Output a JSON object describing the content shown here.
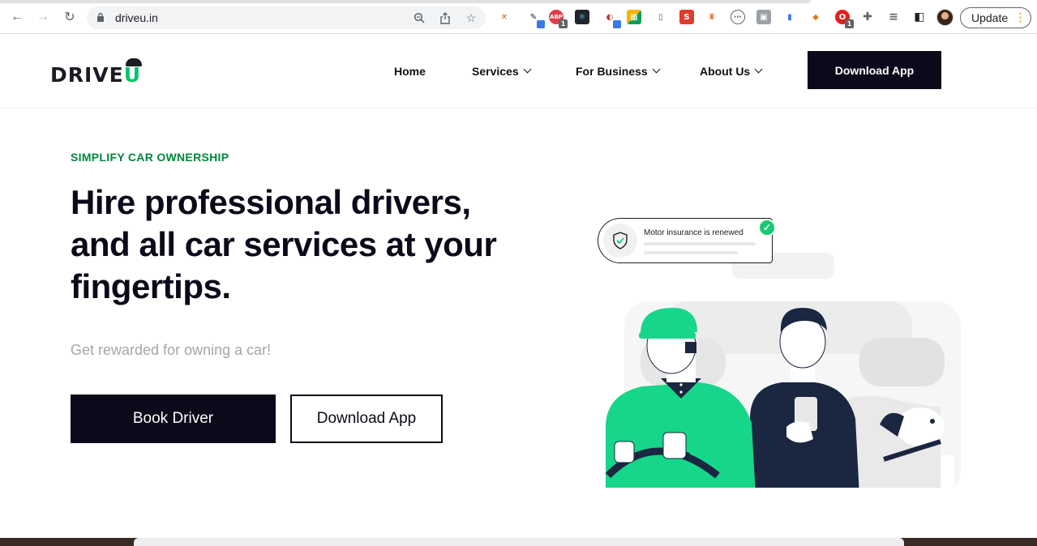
{
  "browser": {
    "url": "driveu.in",
    "update_label": "Update",
    "extensions": [
      {
        "icon": "pencil-x-extension-icon",
        "color": "#e8b339",
        "glyph": "✕"
      },
      {
        "icon": "eyedropper-extension-icon",
        "color": "#ffffff",
        "glyph": "✎"
      },
      {
        "icon": "adblock-extension-icon",
        "color": "#e03c4b",
        "glyph": "ABP",
        "badge": "1"
      },
      {
        "icon": "react-devtools-icon",
        "color": "#20232a",
        "glyph": "⚛"
      },
      {
        "icon": "colorzilla-extension-icon",
        "color": "#ffffff",
        "glyph": "◐"
      },
      {
        "icon": "grid-extension-icon",
        "color": "#ffffff",
        "glyph": "▦"
      },
      {
        "icon": "phone-extension-icon",
        "color": "#ffffff",
        "glyph": "▯"
      },
      {
        "icon": "seo-extension-icon",
        "color": "#e03c2e",
        "glyph": "S"
      },
      {
        "icon": "hacker-extension-icon",
        "color": "#ffffff",
        "glyph": "♜"
      },
      {
        "icon": "loom-extension-icon",
        "color": "#ffffff",
        "glyph": "◎"
      },
      {
        "icon": "screenshot-extension-icon",
        "color": "#ffffff",
        "glyph": "▣"
      },
      {
        "icon": "mobile-view-extension-icon",
        "color": "#ffffff",
        "glyph": "▮"
      },
      {
        "icon": "metamask-extension-icon",
        "color": "#ffffff",
        "glyph": "🦊"
      },
      {
        "icon": "opera-extension-icon",
        "color": "#ffffff",
        "glyph": "O",
        "badge": "1"
      },
      {
        "icon": "puzzle-extensions-icon",
        "color": "#ffffff",
        "glyph": "✚"
      },
      {
        "icon": "media-control-icon",
        "color": "#ffffff",
        "glyph": "≡"
      },
      {
        "icon": "side-panel-icon",
        "color": "#ffffff",
        "glyph": "◧"
      }
    ]
  },
  "site": {
    "nav": {
      "home": "Home",
      "services": "Services",
      "for_business": "For Business",
      "about_us": "About Us",
      "download_app": "Download App"
    },
    "hero": {
      "eyebrow": "SIMPLIFY CAR OWNERSHIP",
      "headline_line1": "Hire professional drivers,",
      "headline_line2": "and all car services at your",
      "headline_line3": "fingertips.",
      "subline": "Get rewarded for owning a car!",
      "book_driver": "Book Driver",
      "download_app": "Download App"
    },
    "notification": {
      "text": "Motor insurance is renewed"
    },
    "colors": {
      "brand_green": "#00c46a",
      "dark": "#0a0a1a",
      "eyebrow_green": "#00873e"
    }
  }
}
